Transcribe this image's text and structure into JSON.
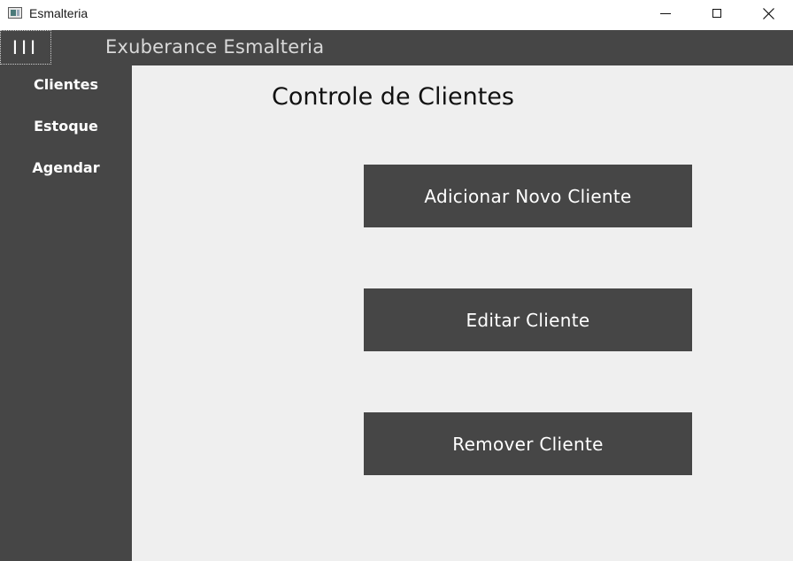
{
  "window": {
    "title": "Esmalteria",
    "controls": {
      "minimize_icon": "minimize-icon",
      "maximize_icon": "maximize-icon",
      "close_icon": "close-icon",
      "close_glyph": "✕"
    }
  },
  "header": {
    "menu_glyph": "III",
    "app_title": "Exuberance Esmalteria",
    "background": "#464646"
  },
  "sidebar": {
    "items": [
      {
        "label": "Clientes"
      },
      {
        "label": "Estoque"
      },
      {
        "label": "Agendar"
      }
    ]
  },
  "main": {
    "title": "Controle de Clientes",
    "buttons": [
      {
        "label": "Adicionar Novo Cliente"
      },
      {
        "label": "Editar Cliente"
      },
      {
        "label": "Remover Cliente"
      }
    ],
    "background": "#efefef",
    "button_color": "#464646"
  }
}
